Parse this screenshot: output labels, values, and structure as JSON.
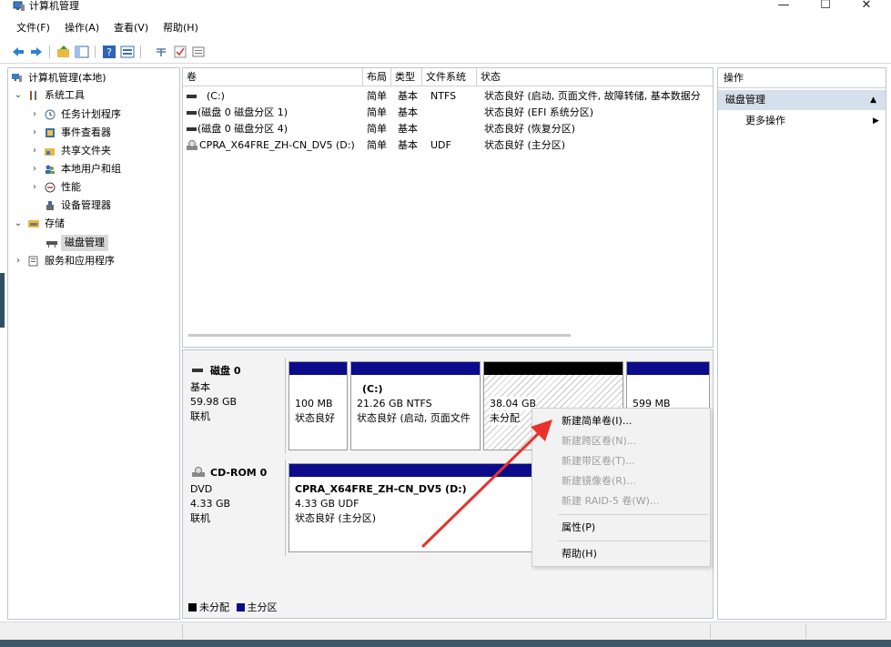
{
  "window": {
    "title": "计算机管理",
    "minimize": "—",
    "maximize": "☐",
    "close": "✕"
  },
  "menu": [
    "文件(F)",
    "操作(A)",
    "查看(V)",
    "帮助(H)"
  ],
  "tree": {
    "root": "计算机管理(本地)",
    "system_tools": "系统工具",
    "task_scheduler": "任务计划程序",
    "event_viewer": "事件查看器",
    "shared_folders": "共享文件夹",
    "local_users": "本地用户和组",
    "performance": "性能",
    "device_manager": "设备管理器",
    "storage": "存储",
    "disk_management": "磁盘管理",
    "services_apps": "服务和应用程序"
  },
  "volume_list": {
    "headers": [
      "卷",
      "布局",
      "类型",
      "文件系统",
      "状态"
    ],
    "rows": [
      [
        "(C:)",
        "简单",
        "基本",
        "NTFS",
        "状态良好 (启动, 页面文件, 故障转储, 基本数据分"
      ],
      [
        "(磁盘 0 磁盘分区 1)",
        "简单",
        "基本",
        "",
        "状态良好 (EFI 系统分区)"
      ],
      [
        "(磁盘 0 磁盘分区 4)",
        "简单",
        "基本",
        "",
        "状态良好 (恢复分区)"
      ],
      [
        "CPRA_X64FRE_ZH-CN_DV5 (D:)",
        "简单",
        "基本",
        "UDF",
        "状态良好 (主分区)"
      ]
    ]
  },
  "disks": {
    "disk0": {
      "name": "磁盘 0",
      "type": "基本",
      "size": "59.98 GB",
      "status": "联机",
      "partitions": [
        {
          "size": "100 MB",
          "status": "状态良好"
        },
        {
          "title": "(C:)",
          "size": "21.26 GB NTFS",
          "status": "状态良好 (启动, 页面文件"
        },
        {
          "size": "38.04 GB",
          "status": "未分配"
        },
        {
          "size": "599 MB",
          "status": ""
        }
      ]
    },
    "cdrom0": {
      "name": "CD-ROM 0",
      "type": "DVD",
      "size": "4.33 GB",
      "status": "联机",
      "partition": {
        "title": "CPRA_X64FRE_ZH-CN_DV5  (D:)",
        "size": "4.33 GB UDF",
        "status": "状态良好 (主分区)"
      }
    }
  },
  "legend": {
    "unallocated": "未分配",
    "primary": "主分区"
  },
  "actions": {
    "header": "操作",
    "section": "磁盘管理",
    "more": "更多操作",
    "section_arrow": "▲",
    "more_arrow": "▶"
  },
  "context_menu": {
    "new_simple": "新建简单卷(I)...",
    "new_spanned": "新建跨区卷(N)...",
    "new_striped": "新建带区卷(T)...",
    "new_mirror": "新建镜像卷(R)...",
    "new_raid5": "新建 RAID-5 卷(W)...",
    "properties": "属性(P)",
    "help": "帮助(H)"
  },
  "colors": {
    "primary_bar": "#0b0b8c",
    "unalloc_bar": "#000000",
    "accent_arrow": "#e8322b",
    "section_bg": "#d6e0ec"
  }
}
